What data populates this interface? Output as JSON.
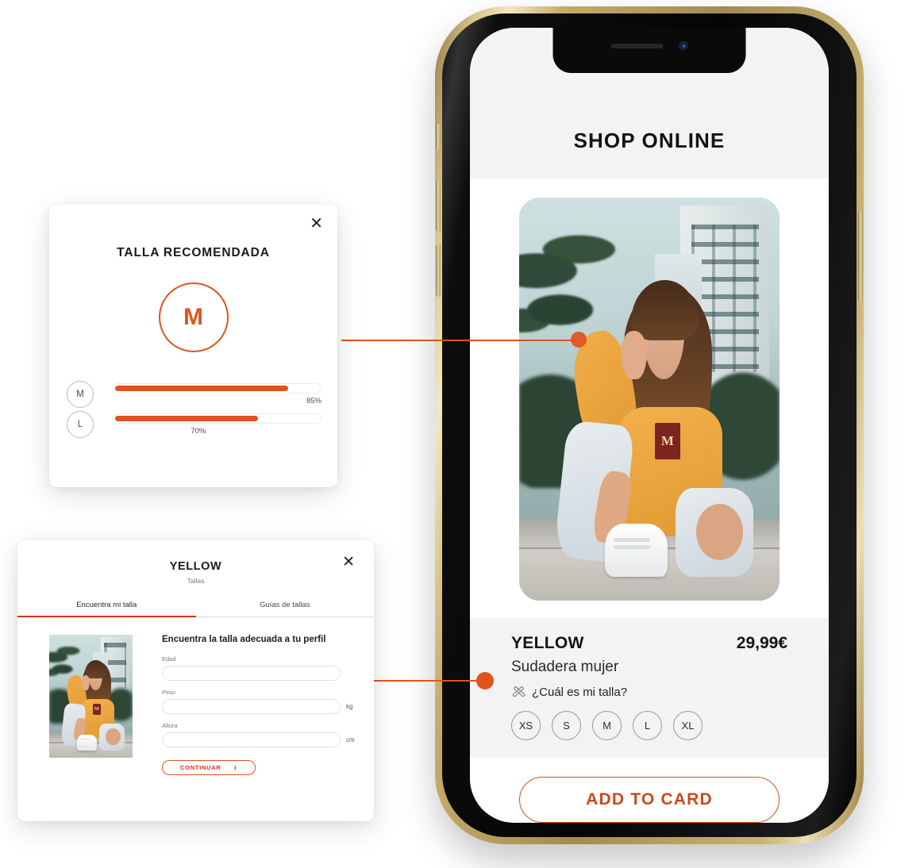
{
  "accent": {
    "orange": "#E0531F",
    "orange_dark": "#C74B1A",
    "tab_red": "#D6301B",
    "gold": "#d8c48b"
  },
  "phone": {
    "app_title": "SHOP ONLINE",
    "product": {
      "brand": "YELLOW",
      "price": "29,99€",
      "description": "Sudadera mujer",
      "size_link_label": "¿Cuál es mi talla?",
      "size_link_icon": "crossed-rulers-icon",
      "sizes": [
        "XS",
        "S",
        "M",
        "L",
        "XL"
      ]
    },
    "cta_label": "ADD TO CARD",
    "hardware": {
      "silent_switch": "silent-switch",
      "volume_up": "volume-up-button",
      "volume_down": "volume-down-button",
      "power": "power-button",
      "speaker": "earpiece-speaker",
      "camera": "front-camera"
    }
  },
  "size_card": {
    "close_icon": "✕",
    "title": "TALLA RECOMENDADA",
    "recommended_size": "M",
    "bars": [
      {
        "label": "M",
        "percent_label": "85%",
        "percent": 85
      },
      {
        "label": "L",
        "percent_label": "70%",
        "percent": 70
      }
    ]
  },
  "finder_card": {
    "close_icon": "✕",
    "brand": "YELLOW",
    "subtitle": "Tallas",
    "tabs": [
      {
        "label": "Encuentra mi talla",
        "active": true
      },
      {
        "label": "Guías de tallas",
        "active": false
      }
    ],
    "form": {
      "heading": "Encuentra la talla adecuada a tu perfil",
      "fields": [
        {
          "label": "Edad",
          "value": "",
          "placeholder": "",
          "unit": ""
        },
        {
          "label": "Peso",
          "value": "",
          "placeholder": "",
          "unit": "kg"
        },
        {
          "label": "Altura",
          "value": "",
          "placeholder": "",
          "unit": "cm"
        }
      ],
      "submit_label": "CONTINUAR",
      "submit_chevron": "›"
    },
    "photo_letter": "M"
  },
  "photo": {
    "sweater_letter": "M"
  },
  "connectors": [
    {
      "name": "size-card-to-sleeve"
    },
    {
      "name": "finder-card-to-size-link"
    }
  ]
}
